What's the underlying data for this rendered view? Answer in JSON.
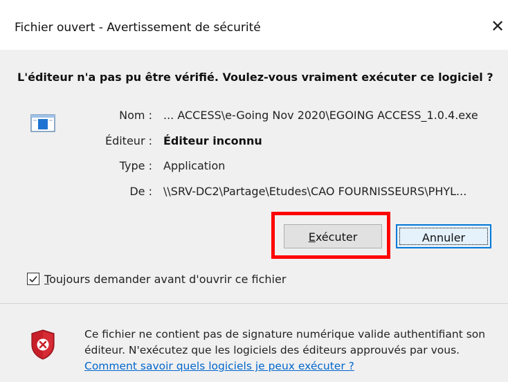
{
  "dialog": {
    "title": "Fichier ouvert - Avertissement de sécurité",
    "close_glyph": "✕",
    "question": "L'éditeur n'a pas pu être vérifié. Voulez-vous vraiment exécuter ce logiciel ?",
    "app_icon": "application-window-icon",
    "fields": [
      {
        "label": "Nom :",
        "value": "... ACCESS\\e-Going Nov 2020\\EGOING ACCESS_1.0.4.exe"
      },
      {
        "label": "Éditeur :",
        "value": "Éditeur inconnu"
      },
      {
        "label": "Type :",
        "value": "Application"
      },
      {
        "label": "De :",
        "value": "\\\\SRV-DC2\\Partage\\Etudes\\CAO FOURNISSEURS\\PHYL..."
      }
    ],
    "buttons": {
      "execute_accel": "E",
      "execute_rest": "xécuter",
      "cancel": "Annuler"
    },
    "checkbox": {
      "checked": true,
      "accel": "T",
      "rest": "oujours demander avant d'ouvrir ce fichier"
    },
    "footer": {
      "shield_icon": "shield-warning-icon",
      "text": "Ce fichier ne contient pas de signature numérique valide authentifiant son éditeur. N'exécutez que les logiciels des éditeurs approuvés par vous.",
      "link": "Comment savoir quels logiciels je peux exécuter ?"
    },
    "colors": {
      "highlight": "#ff0000",
      "link": "#0066cc",
      "default_button_border": "#0078d7",
      "panel": "#f0f0f0"
    }
  }
}
